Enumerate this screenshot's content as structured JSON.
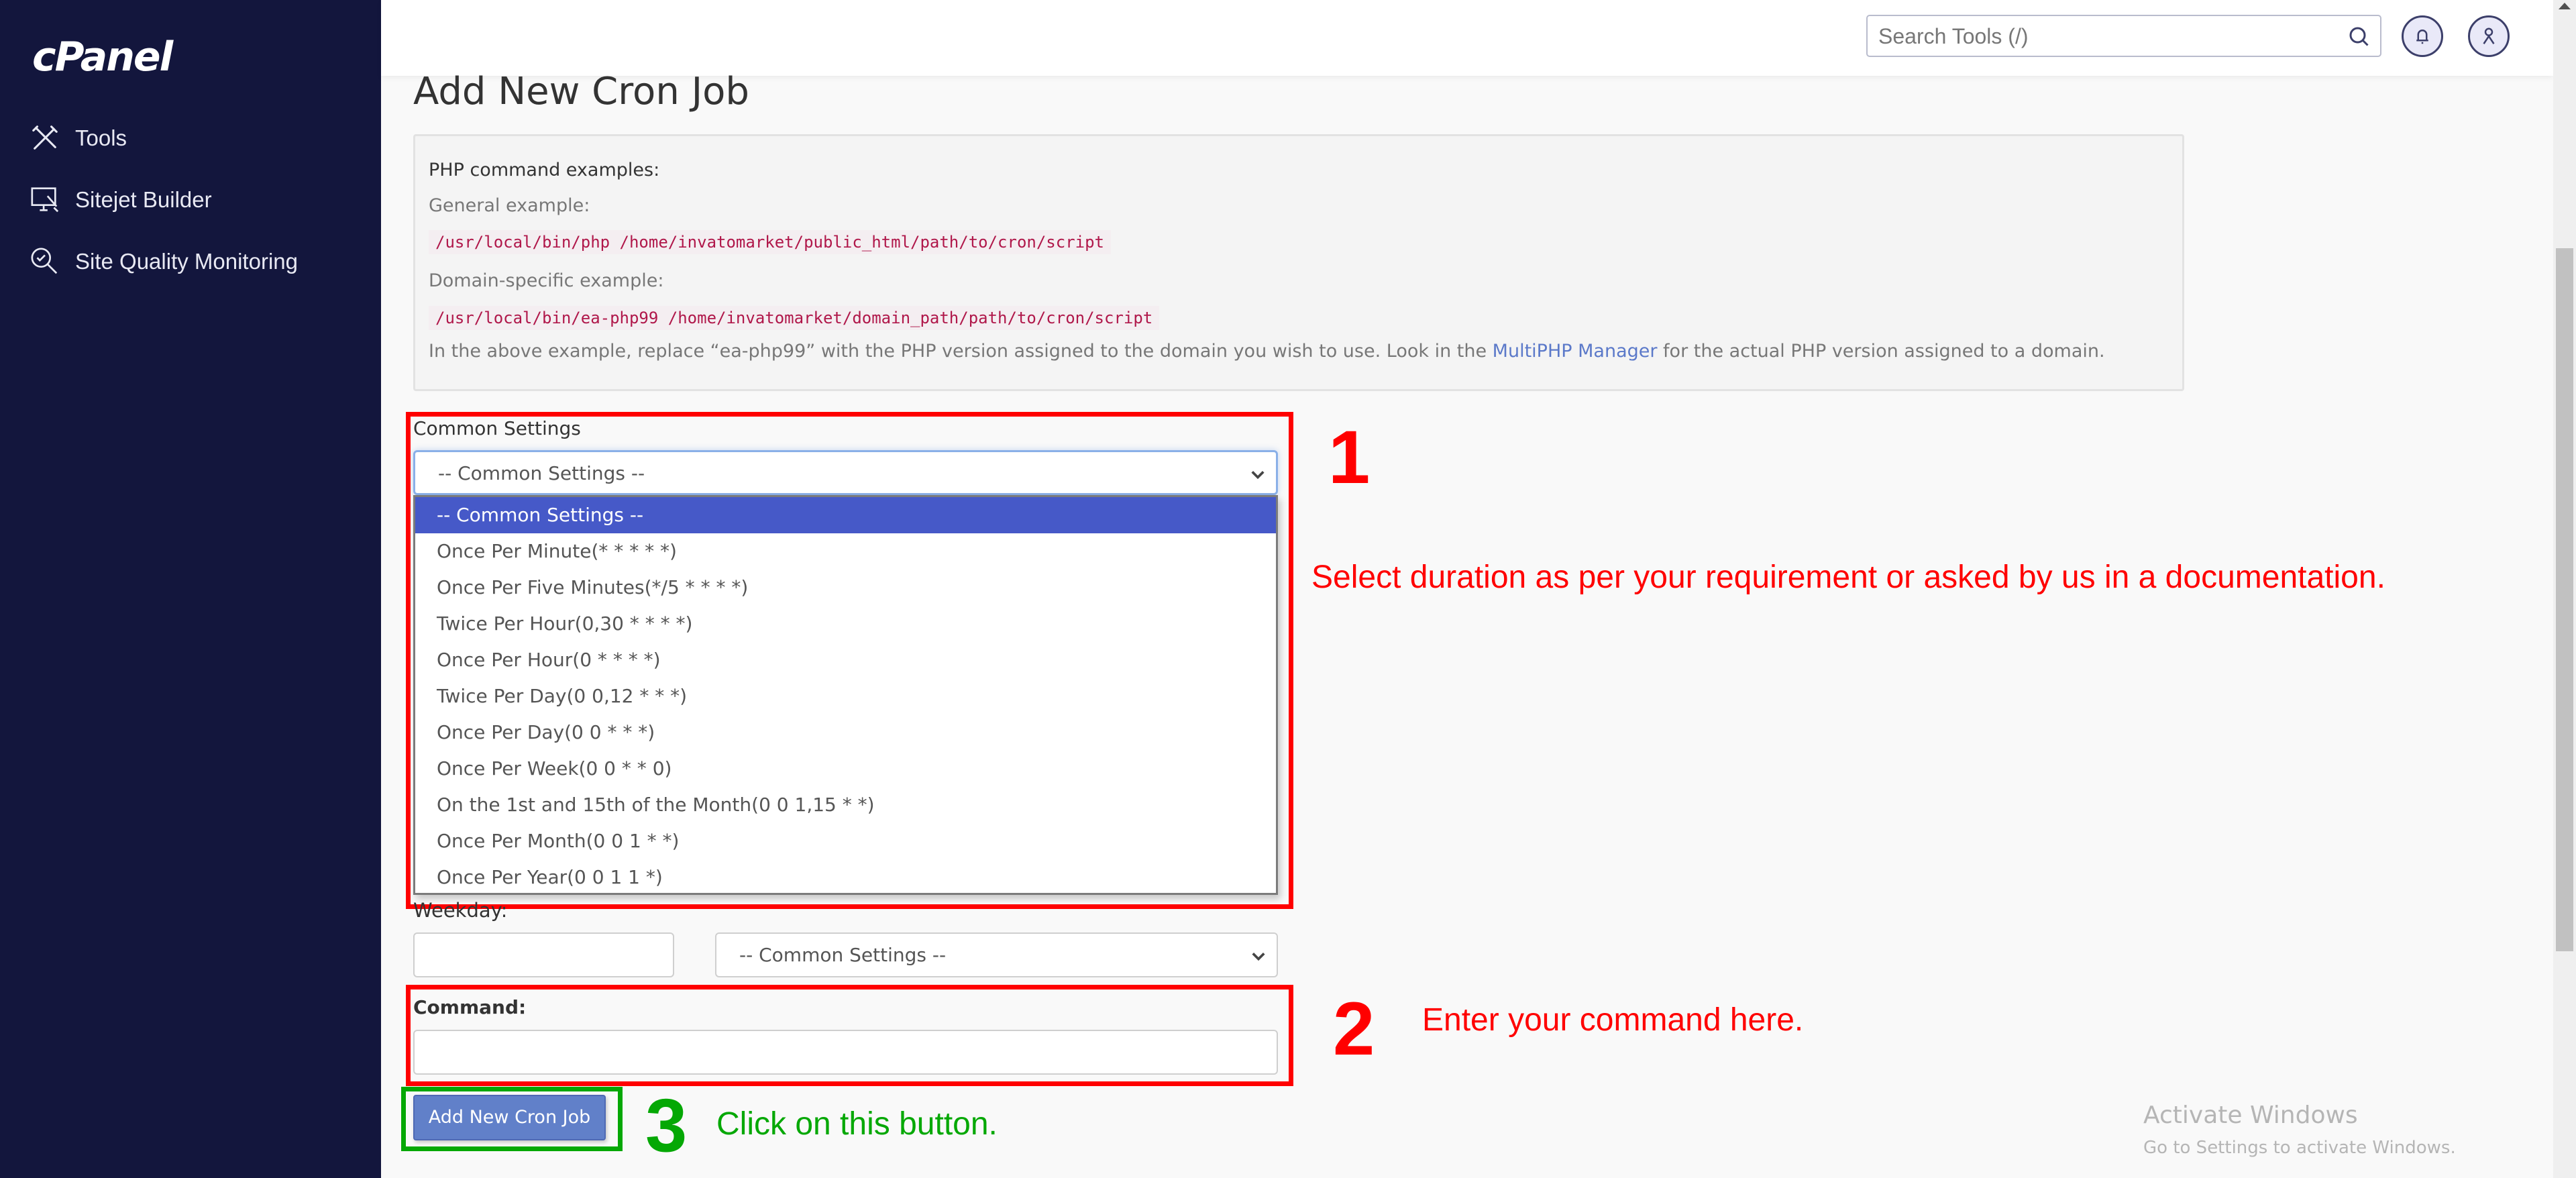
{
  "sidebar": {
    "logo": "cPanel",
    "items": [
      {
        "label": "Tools",
        "icon": "tools-icon"
      },
      {
        "label": "Sitejet Builder",
        "icon": "sitejet-builder-icon"
      },
      {
        "label": "Site Quality Monitoring",
        "icon": "site-quality-monitoring-icon"
      }
    ]
  },
  "header": {
    "search_placeholder": "Search Tools (/)",
    "search_icon": "search-icon",
    "notifications_icon": "bell-icon",
    "user_icon": "user-icon"
  },
  "page": {
    "title": "Add New Cron Job"
  },
  "examples": {
    "heading": "PHP command examples:",
    "general_label": "General example:",
    "general_code": "/usr/local/bin/php /home/invatomarket/public_html/path/to/cron/script",
    "domain_label": "Domain-specific example:",
    "domain_code": "/usr/local/bin/ea-php99 /home/invatomarket/domain_path/path/to/cron/script",
    "note_before": "In the above example, replace “ea-php99” with the PHP version assigned to the domain you wish to use. Look in the ",
    "note_link": "MultiPHP Manager",
    "note_after": " for the actual PHP version assigned to a domain."
  },
  "common_settings": {
    "label": "Common Settings",
    "selected": "-- Common Settings --",
    "options": [
      "-- Common Settings --",
      "Once Per Minute(* * * * *)",
      "Once Per Five Minutes(*/5 * * * *)",
      "Twice Per Hour(0,30 * * * *)",
      "Once Per Hour(0 * * * *)",
      "Twice Per Day(0 0,12 * * *)",
      "Once Per Day(0 0 * * *)",
      "Once Per Week(0 0 * * 0)",
      "On the 1st and 15th of the Month(0 0 1,15 * *)",
      "Once Per Month(0 0 1 * *)",
      "Once Per Year(0 0 1 1 *)"
    ],
    "highlighted_index": 0
  },
  "weekday": {
    "label": "Weekday:",
    "value": "",
    "select_value": "-- Common Settings --"
  },
  "command": {
    "label": "Command:",
    "value": ""
  },
  "submit": {
    "label": "Add New Cron Job"
  },
  "annotations": {
    "step1_number": "1",
    "step1_text": "Select duration as per your requirement or asked by us in a documentation.",
    "step2_number": "2",
    "step2_text": "Enter your command here.",
    "step3_number": "3",
    "step3_text": "Click on this button.",
    "colors": {
      "red": "#ff0000",
      "green": "#05a805"
    }
  },
  "watermark": {
    "title": "Activate Windows",
    "subtitle": "Go to Settings to activate Windows."
  },
  "colors": {
    "sidebar_bg": "#13163d",
    "highlight": "#4659c8",
    "button": "#6180c9",
    "code": "#b0174a",
    "link": "#5b79c9"
  }
}
